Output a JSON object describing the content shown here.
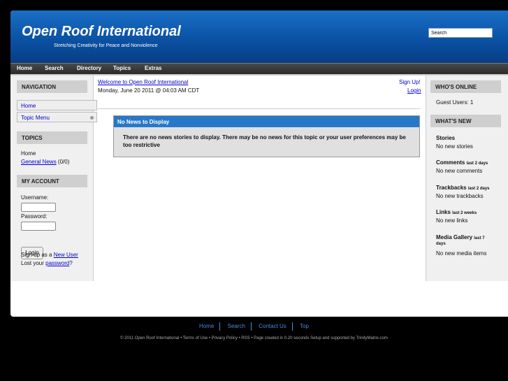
{
  "header": {
    "title": "Open Roof International",
    "slogan": "Stretching Creativity for Peace and Nonviolence",
    "search_value": "Search"
  },
  "nav": [
    "Home",
    "Search",
    "Directory",
    "Topics",
    "Extras"
  ],
  "left": {
    "navigation_title": "NAVIGATION",
    "menu": [
      "Home",
      "Topic Menu"
    ],
    "topics_title": "TOPICS",
    "topics_home": "Home",
    "topics_general": "General News",
    "topics_general_count": "(0/0)",
    "account_title": "MY ACCOUNT",
    "username_label": "Username:",
    "password_label": "Password:",
    "login_button": "Login",
    "signup_prefix": "Sign up as a",
    "signup_link": "New User",
    "lost_prefix": "Lost your",
    "lost_link": "password",
    "lost_suffix": "?"
  },
  "center": {
    "welcome": "Welcome to Open Roof International",
    "date": "Monday, June 20 2011 @ 04:03 AM CDT",
    "signup": "Sign Up!",
    "login": "Login",
    "news_title": "No News to Display",
    "news_body": "There are no news stories to display. There may be no news for this topic or your user preferences may be too restrictive"
  },
  "right": {
    "online_title": "WHO'S ONLINE",
    "guest_users": "Guest Users: 1",
    "whats_new_title": "WHAT'S NEW",
    "stories_title": "Stories",
    "stories_text": "No new stories",
    "comments_title": "Comments",
    "comments_period": "last 2 days",
    "comments_text": "No new comments",
    "trackbacks_title": "Trackbacks",
    "trackbacks_period": "last 2 days",
    "trackbacks_text": "No new trackbacks",
    "links_title": "Links",
    "links_period": "last 2 weeks",
    "links_text": "No new links",
    "media_title": "Media Gallery",
    "media_period_a": "last 7",
    "media_period_b": "days",
    "media_text": "No new media items"
  },
  "footer": {
    "links": [
      "Home",
      "Search",
      "Contact Us",
      "Top"
    ],
    "copyright": "© 2011 Open Roof International  •  Terms of Use  •  Privacy Policy  •  RSS  •  Page created in 0.20 seconds Setup and supported by TrinityMatrix.com"
  },
  "colors": {
    "header_blue": "#0a4fa0",
    "news_title_blue": "#2878c8",
    "link_blue": "#0000cc"
  }
}
